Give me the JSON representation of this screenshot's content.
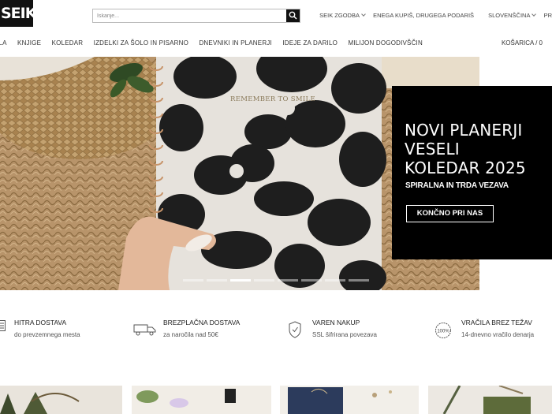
{
  "header": {
    "logo_text": "SEIK",
    "search_placeholder": "Iskanje...",
    "links": [
      "SEIK ZGODBA",
      "ENEGA KUPIŠ, DRUGEGA PODARIŠ",
      "SLOVENŠČINA",
      "PR"
    ]
  },
  "nav": {
    "items": [
      "ILA",
      "KNJIGE",
      "KOLEDAR",
      "IZDELKI ZA ŠOLO IN PISARNO",
      "DNEVNIKI IN PLANERJI",
      "IDEJE ZA DARILO",
      "MILIJON DOGODIVŠČIN"
    ],
    "cart_label": "KOŠARICA / 0"
  },
  "hero": {
    "notebook_text": "REMEMBER TO SMILE",
    "title_lines": [
      "NOVI PLANERJI",
      "VESELI",
      "KOLEDAR 2025"
    ],
    "subtitle": "SPIRALNA IN TRDA VEZAVA",
    "cta_label": "KONČNO PRI NAS",
    "slide_count": 8,
    "active_slide": 3
  },
  "features": [
    {
      "title": "HITRA DOSTAVA",
      "sub": "do prevzemnega mesta",
      "icon": "list-icon"
    },
    {
      "title": "BREZPLAČNA DOSTAVA",
      "sub": "za naročila nad 50€",
      "icon": "truck-icon"
    },
    {
      "title": "VAREN NAKUP",
      "sub": "SSL šifrirana povezava",
      "icon": "shield-icon"
    },
    {
      "title": "VRAČILA BREZ TEŽAV",
      "sub": "14-dnevno vračilo denarja",
      "icon": "guarantee-icon"
    }
  ],
  "feature_icon_text": "100%",
  "colors": {
    "brand_black": "#111111",
    "panel_black": "#000000",
    "text": "#222222"
  }
}
